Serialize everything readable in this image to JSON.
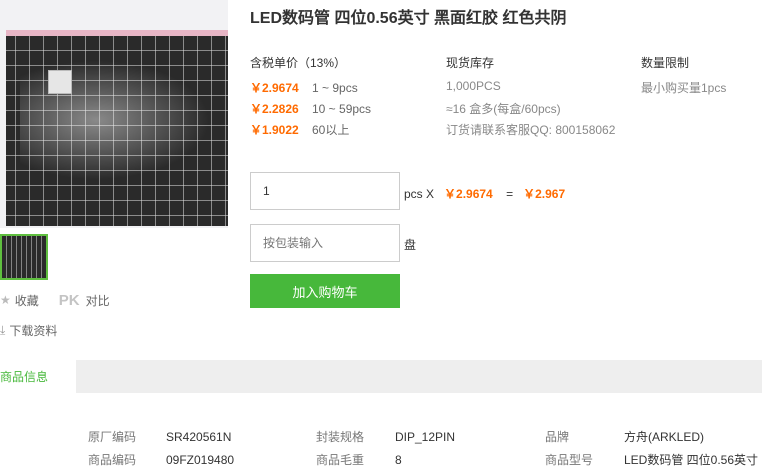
{
  "product": {
    "title": "LED数码管 四位0.56英寸 黑面红胶 红色共阴",
    "thumbnail_count": 1
  },
  "side_actions": {
    "favorite_label": "收藏",
    "compare_icon_text": "PK",
    "compare_label": "对比",
    "download_label": "下载资料"
  },
  "pricing": {
    "header": "含税单价（13%）",
    "tiers": [
      {
        "price": "￥2.9674",
        "qty": "1 ~ 9pcs"
      },
      {
        "price": "￥2.2826",
        "qty": "10 ~ 59pcs"
      },
      {
        "price": "￥1.9022",
        "qty": "60以上"
      }
    ]
  },
  "stock": {
    "header": "现货库存",
    "lines": [
      "1,000PCS",
      "≈16 盒多(每盒/60pcs)",
      "订货请联系客服QQ: 800158062"
    ]
  },
  "limit": {
    "header": "数量限制",
    "text": "最小购买量1pcs"
  },
  "order": {
    "quantity_value": "1",
    "unit": "pcs X",
    "unit_price": "￥2.9674",
    "equals": "=",
    "total": "￥2.967",
    "pack_placeholder": "按包装输入",
    "pack_unit": "盘",
    "add_to_cart_label": "加入购物车"
  },
  "tabs": {
    "active": "商品信息"
  },
  "specs": [
    {
      "key": "原厂编码",
      "value": "SR420561N"
    },
    {
      "key": "封装规格",
      "value": "DIP_12PIN"
    },
    {
      "key": "品牌",
      "value": "方舟(ARKLED)"
    },
    {
      "key": "商品编码",
      "value": "09FZ019480"
    },
    {
      "key": "商品毛重",
      "value": "8"
    },
    {
      "key": "商品型号",
      "value": "LED数码管 四位0.56英寸"
    }
  ],
  "colors": {
    "accent_green": "#47b83b",
    "price_orange": "#ff6a00"
  }
}
